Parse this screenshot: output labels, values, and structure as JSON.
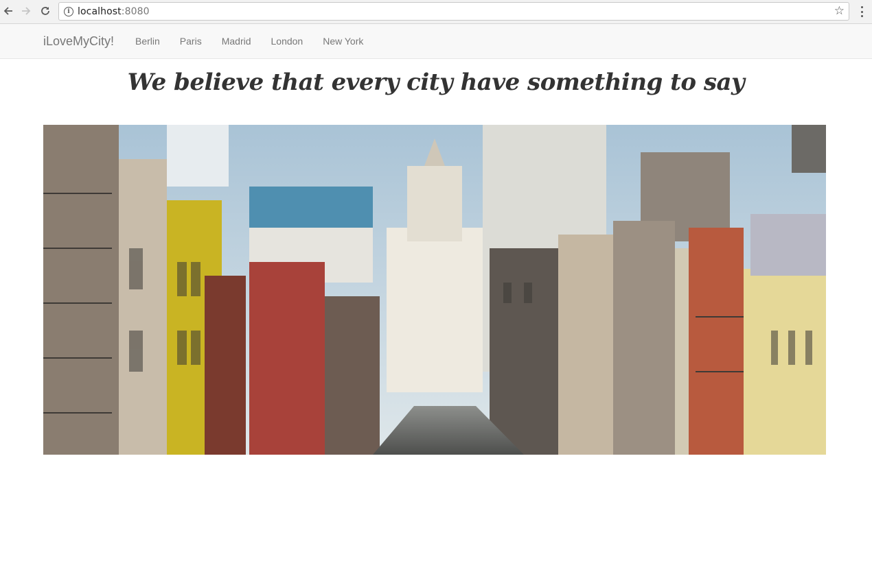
{
  "browser": {
    "url_host": "localhost",
    "url_port": ":8080",
    "back_icon": "back-arrow-icon",
    "forward_icon": "forward-arrow-icon",
    "reload_icon": "reload-icon",
    "info_icon": "info-icon",
    "star_icon": "star-icon",
    "menu_icon": "kebab-menu-icon"
  },
  "navbar": {
    "brand": "iLoveMyCity!",
    "items": [
      {
        "label": "Berlin"
      },
      {
        "label": "Paris"
      },
      {
        "label": "Madrid"
      },
      {
        "label": "London"
      },
      {
        "label": "New York"
      }
    ]
  },
  "main": {
    "headline": "We believe that every city have something to say"
  },
  "colors": {
    "navbar_bg": "#f8f8f8",
    "nav_text": "#777777",
    "headline_text": "#333333"
  }
}
